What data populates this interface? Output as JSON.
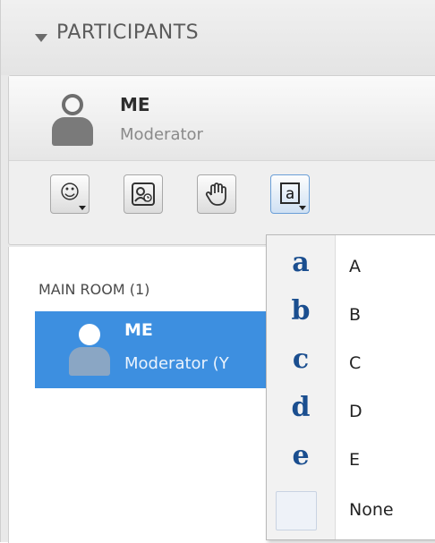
{
  "header": {
    "title": "PARTICIPANTS"
  },
  "me": {
    "name": "ME",
    "role": "Moderator"
  },
  "toolbar": {
    "emoji_icon": "smiley-icon",
    "status_icon": "user-clock-icon",
    "raise_hand_icon": "hand-icon",
    "answer_icon": "answer-letter-icon",
    "answer_glyph": "a"
  },
  "room": {
    "label": "MAIN ROOM (1)",
    "participant": {
      "name": "ME",
      "role": "Moderator (Y"
    }
  },
  "answer_menu": {
    "items": [
      {
        "glyph": "a",
        "label": "A"
      },
      {
        "glyph": "b",
        "label": "B"
      },
      {
        "glyph": "c",
        "label": "C"
      },
      {
        "glyph": "d",
        "label": "D"
      },
      {
        "glyph": "e",
        "label": "E"
      },
      {
        "glyph": "",
        "label": "None"
      }
    ]
  },
  "colors": {
    "selection": "#3d8fe0",
    "menu_letters": "#1a4e8f",
    "header_text": "#5b5b5b"
  }
}
